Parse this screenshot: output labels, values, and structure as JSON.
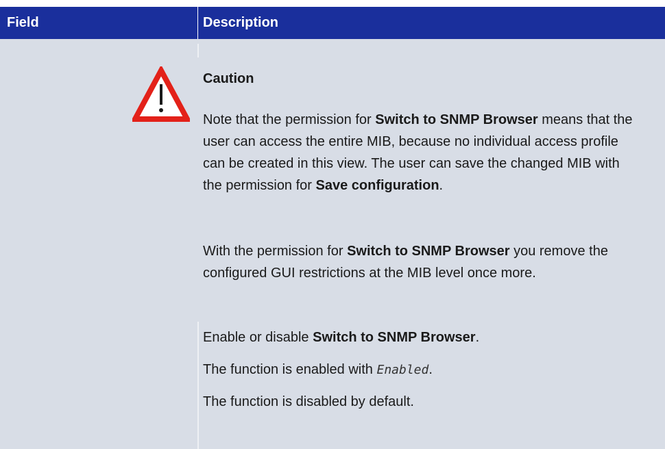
{
  "header": {
    "field_label": "Field",
    "description_label": "Description"
  },
  "caution": {
    "title": "Caution",
    "icon": "warning-triangle-icon",
    "icon_color": "#e32119"
  },
  "paragraph1": {
    "t1": "Note that the permission for ",
    "b1": "Switch to SNMP Browser",
    "t2": " means that the user can access the entire MIB, because no individual access profile can be created in this view. The user can save the changed MIB with the permission for ",
    "b2": "Save configuration",
    "t3": "."
  },
  "paragraph2": {
    "t1": "With the permission for ",
    "b1": "Switch to SNMP Browser",
    "t2": " you remove the configured GUI restrictions at the MIB level once more."
  },
  "paragraph3": {
    "t1": "Enable or disable ",
    "b1": "Switch to SNMP Browser",
    "t2": "."
  },
  "paragraph4": {
    "t1": "The function is enabled with ",
    "code": "Enabled",
    "t2": "."
  },
  "paragraph5": "The function is disabled by default.",
  "colors": {
    "header_bg": "#1a2f9c",
    "body_bg": "#d8dde6"
  }
}
